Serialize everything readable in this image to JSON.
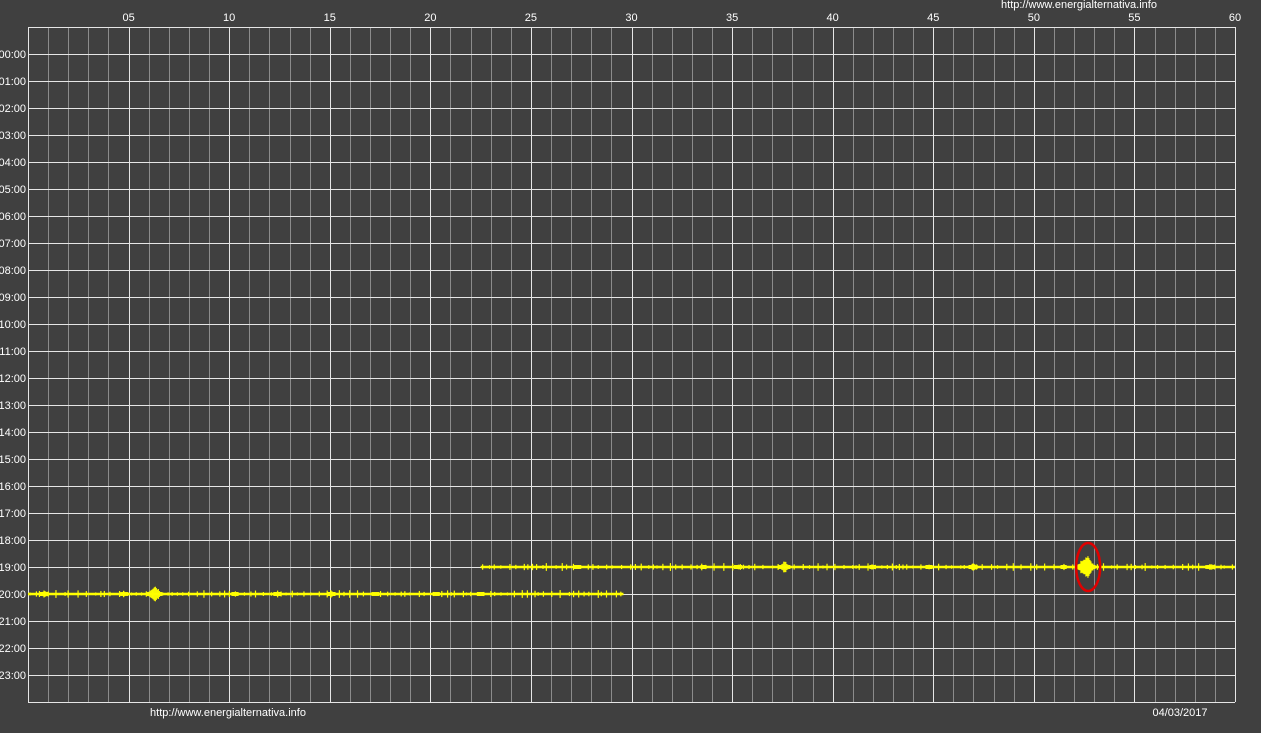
{
  "watermark_top": "http://www.energialternativa.info",
  "watermark_bottom": "http://www.energialternativa.info",
  "date": "04/03/2017",
  "colors": {
    "background": "#404040",
    "grid_major": "#e6e6e6",
    "grid_minor": "#8c8c8c",
    "text": "#ffffff",
    "trace": "#ffff00",
    "highlight": "#e00000"
  },
  "chart_data": {
    "type": "line",
    "x_axis": {
      "range": [
        0,
        60
      ],
      "major_step": 5,
      "minor_step": 1,
      "tick_labels": [
        "05",
        "10",
        "15",
        "20",
        "25",
        "30",
        "35",
        "40",
        "45",
        "50",
        "55",
        "60"
      ]
    },
    "y_axis": {
      "tick_labels": [
        "00:00",
        "01:00",
        "02:00",
        "03:00",
        "04:00",
        "05:00",
        "06:00",
        "07:00",
        "08:00",
        "09:00",
        "10:00",
        "11:00",
        "12:00",
        "13:00",
        "14:00",
        "15:00",
        "16:00",
        "17:00",
        "18:00",
        "19:00",
        "20:00",
        "21:00",
        "22:00",
        "23:00"
      ]
    },
    "grid": true,
    "series": [
      {
        "row": "19:00",
        "x_start": 22.5,
        "x_end": 60,
        "events": [
          {
            "x": 27.3,
            "amp": 0.25
          },
          {
            "x": 33.6,
            "amp": 0.15
          },
          {
            "x": 35.3,
            "amp": 0.25
          },
          {
            "x": 37.6,
            "amp": 0.6
          },
          {
            "x": 42.0,
            "amp": 0.15
          },
          {
            "x": 44.8,
            "amp": 0.2
          },
          {
            "x": 47.0,
            "amp": 0.4
          },
          {
            "x": 51.5,
            "amp": 0.15
          },
          {
            "x": 52.6,
            "amp": 1.2
          },
          {
            "x": 58.8,
            "amp": 0.35
          }
        ]
      },
      {
        "row": "20:00",
        "x_start": 0,
        "x_end": 29.6,
        "events": [
          {
            "x": 0.8,
            "amp": 0.35
          },
          {
            "x": 4.8,
            "amp": 0.3
          },
          {
            "x": 6.3,
            "amp": 0.9
          },
          {
            "x": 10.3,
            "amp": 0.2
          },
          {
            "x": 12.4,
            "amp": 0.25
          },
          {
            "x": 15.1,
            "amp": 0.3
          },
          {
            "x": 17.3,
            "amp": 0.2
          },
          {
            "x": 20.3,
            "amp": 0.2
          },
          {
            "x": 22.5,
            "amp": 0.2
          }
        ]
      }
    ],
    "annotations": [
      {
        "shape": "ellipse",
        "x": 52.7,
        "row": "19:00"
      }
    ]
  }
}
